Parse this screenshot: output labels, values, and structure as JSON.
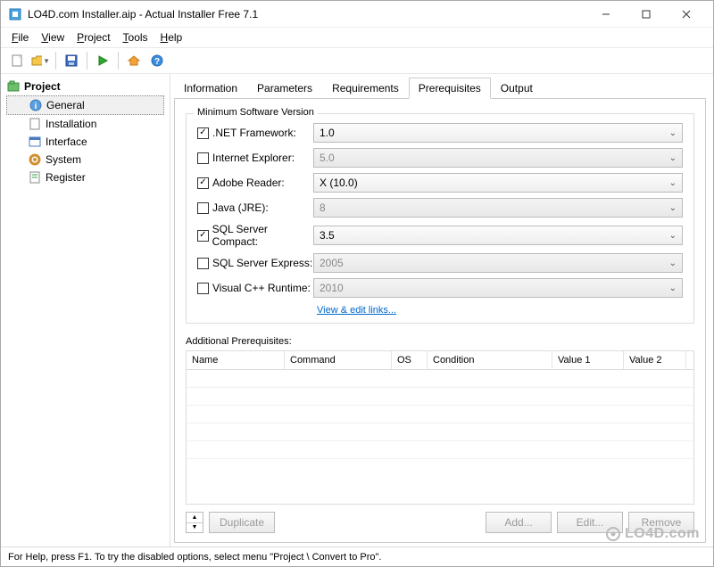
{
  "window": {
    "title": "LO4D.com Installer.aip - Actual Installer Free 7.1"
  },
  "menu": {
    "file": "File",
    "view": "View",
    "project": "Project",
    "tools": "Tools",
    "help": "Help"
  },
  "sidebar": {
    "root": "Project",
    "items": [
      {
        "label": "General",
        "selected": true
      },
      {
        "label": "Installation"
      },
      {
        "label": "Interface"
      },
      {
        "label": "System"
      },
      {
        "label": "Register"
      }
    ]
  },
  "tabs": {
    "items": [
      "Information",
      "Parameters",
      "Requirements",
      "Prerequisites",
      "Output"
    ],
    "active": "Prerequisites"
  },
  "group_label": "Minimum Software Version",
  "prereq_rows": [
    {
      "label": ".NET Framework:",
      "checked": true,
      "value": "1.0",
      "enabled": true
    },
    {
      "label": "Internet Explorer:",
      "checked": false,
      "value": "5.0",
      "enabled": false
    },
    {
      "label": "Adobe Reader:",
      "checked": true,
      "value": "X (10.0)",
      "enabled": true
    },
    {
      "label": "Java (JRE):",
      "checked": false,
      "value": "8",
      "enabled": false
    },
    {
      "label": "SQL Server Compact:",
      "checked": true,
      "value": "3.5",
      "enabled": true
    },
    {
      "label": "SQL Server Express:",
      "checked": false,
      "value": "2005",
      "enabled": false
    },
    {
      "label": "Visual C++ Runtime:",
      "checked": false,
      "value": "2010",
      "enabled": false
    }
  ],
  "link_text": "View & edit links...",
  "additional_label": "Additional Prerequisites:",
  "grid": {
    "columns": [
      "Name",
      "Command",
      "OS",
      "Condition",
      "Value 1",
      "Value 2"
    ]
  },
  "buttons": {
    "duplicate": "Duplicate",
    "add": "Add...",
    "edit": "Edit...",
    "remove": "Remove"
  },
  "statusbar": "For Help, press F1.  To try the disabled options, select menu \"Project \\ Convert to Pro\".",
  "watermark": "LO4D.com"
}
